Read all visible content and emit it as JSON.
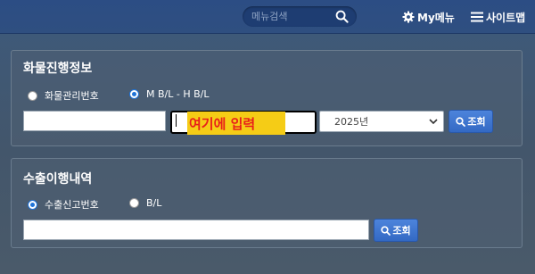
{
  "header": {
    "search_placeholder": "메뉴검색",
    "my_menu_label": "My메뉴",
    "sitemap_label": "사이트맵"
  },
  "cargo_panel": {
    "title": "화물진행정보",
    "radio_options": [
      {
        "label": "화물관리번호",
        "checked": false
      },
      {
        "label": "M B/L - H B/L",
        "checked": true
      }
    ],
    "mbl_value": "",
    "hbl_value": "",
    "overlay_text": "여기에 입력",
    "year_select": "2025년",
    "search_button": "조회"
  },
  "export_panel": {
    "title": "수출이행내역",
    "radio_options": [
      {
        "label": "수출신고번호",
        "checked": true
      },
      {
        "label": "B/L",
        "checked": false
      }
    ],
    "input_value": "",
    "search_button": "조회"
  },
  "colors": {
    "accent": "#3369c4",
    "overlay_bg": "#f5cc16",
    "overlay_text": "#e8201a"
  }
}
